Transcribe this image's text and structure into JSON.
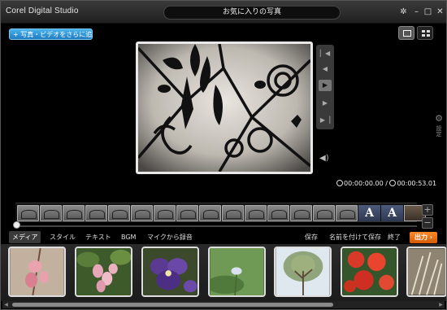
{
  "app": {
    "title": "Corel Digital Studio",
    "project_title": "お気に入りの写真"
  },
  "toolbar": {
    "add_media_label": "写真・ビデオをさらに追加"
  },
  "preview": {
    "time_current": "00:00:00.00",
    "time_separator": " / ",
    "time_total": "00:00:53.01"
  },
  "side": {
    "settings_label": "設定"
  },
  "timeline": {
    "photo_clips": 15,
    "text_clip_label": "A"
  },
  "tabs": [
    {
      "label": "メディア"
    },
    {
      "label": "スタイル"
    },
    {
      "label": "テキスト"
    },
    {
      "label": "BGM"
    },
    {
      "label": "マイクから録音"
    }
  ],
  "actions": {
    "save": "保存",
    "save_as": "名前を付けて保存",
    "finish": "終了",
    "output": "出力"
  },
  "library": {
    "items": [
      "cherry-blossom",
      "pink-flowers",
      "purple-pansy",
      "white-flower-bud",
      "tree",
      "red-dahlias",
      "dried-grass"
    ]
  },
  "colors": {
    "accent_blue": "#2b8fd6",
    "output_orange": "#e8700f",
    "background": "#000000"
  }
}
